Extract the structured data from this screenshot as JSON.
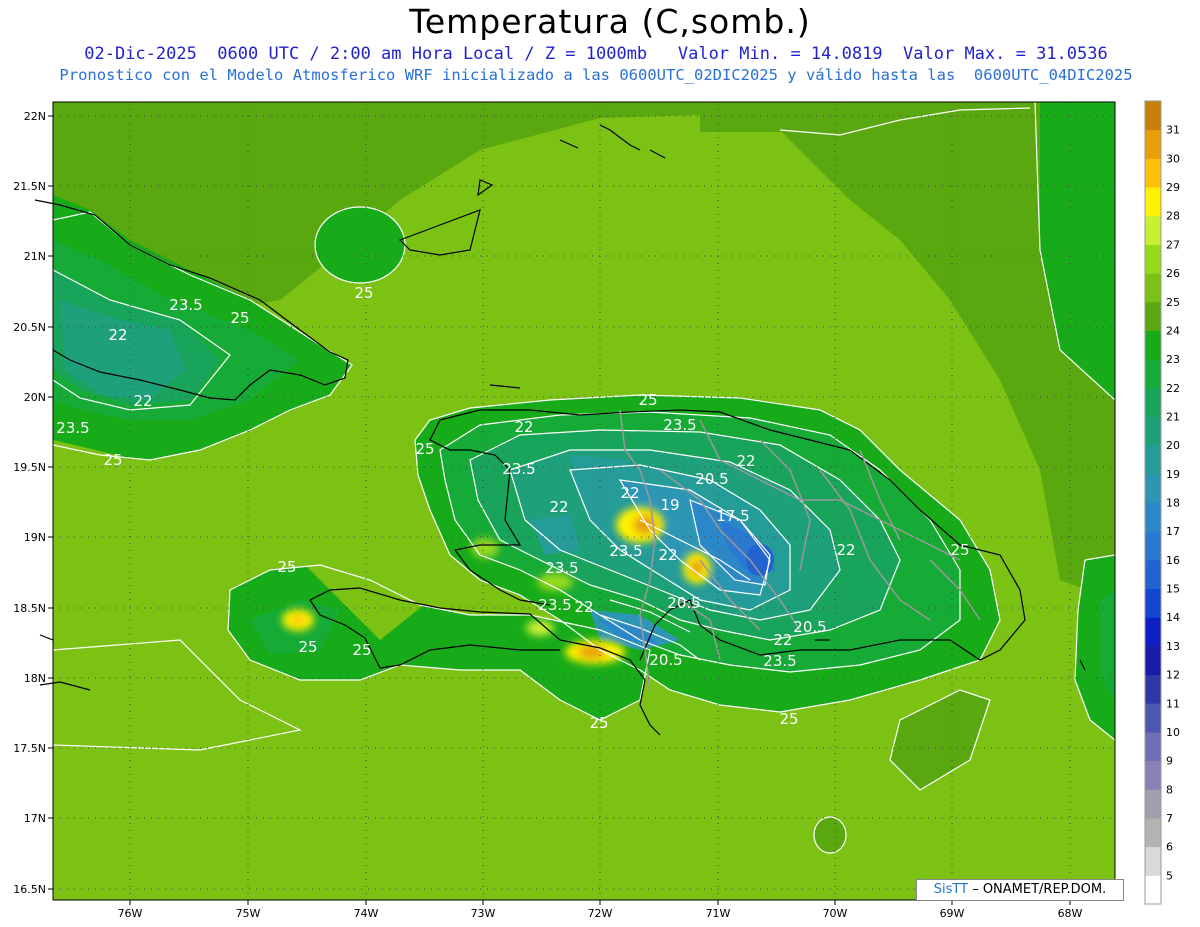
{
  "header": {
    "title": "Temperatura (C,somb.)",
    "line1": "02-Dic-2025  0600 UTC / 2:00 am Hora Local / Z = 1000mb   Valor Min. = 14.0819  Valor Max. = 31.0536",
    "line2": "Pronostico con el Modelo Atmosferico WRF inicializado a las 0600UTC_02DIC2025 y válido hasta las  0600UTC_04DIC2025"
  },
  "axes": {
    "lat_labels": [
      "22N",
      "21.5N",
      "21N",
      "20.5N",
      "20N",
      "19.5N",
      "19N",
      "18.5N",
      "18N",
      "17.5N",
      "17N",
      "16.5N"
    ],
    "lon_labels": [
      "76W",
      "75W",
      "74W",
      "73W",
      "72W",
      "71W",
      "70W",
      "69W",
      "68W"
    ]
  },
  "legend": {
    "levels": [
      "5",
      "6",
      "7",
      "8",
      "9",
      "10",
      "11",
      "12",
      "13",
      "14",
      "15",
      "16",
      "17",
      "18",
      "19",
      "20",
      "21",
      "22",
      "23",
      "24",
      "25",
      "26",
      "27",
      "28",
      "29",
      "30",
      "31"
    ],
    "colors": [
      "#ffffff",
      "#d9d9d9",
      "#b3b3b3",
      "#9f9fae",
      "#8b7fb8",
      "#6f6fb5",
      "#4e57b0",
      "#3038a8",
      "#1a1aa6",
      "#0e1fc4",
      "#1446cf",
      "#2363cf",
      "#2a78d0",
      "#2c87c8",
      "#2e96b5",
      "#259c97",
      "#1ea07a",
      "#18a45a",
      "#16aa36",
      "#17ab1a",
      "#5aa80f",
      "#7cc214",
      "#96d81a",
      "#c8f030",
      "#fff200",
      "#ffc107",
      "#e8a00a",
      "#c88008"
    ]
  },
  "contour_labels": [
    "25",
    "23.5",
    "22",
    "22",
    "23.5",
    "25",
    "25",
    "25",
    "22",
    "20.5",
    "19",
    "17.5",
    "22",
    "23.5",
    "25",
    "22",
    "23.5",
    "23.5",
    "22",
    "20.5",
    "23.5",
    "22",
    "20.5",
    "23.5",
    "25",
    "25",
    "25",
    "22",
    "20.5",
    "25",
    "23.5",
    "25",
    "22",
    "22",
    "25"
  ],
  "credit": {
    "logo": "SisTT",
    "text": " – ONAMET/REP.DOM."
  }
}
